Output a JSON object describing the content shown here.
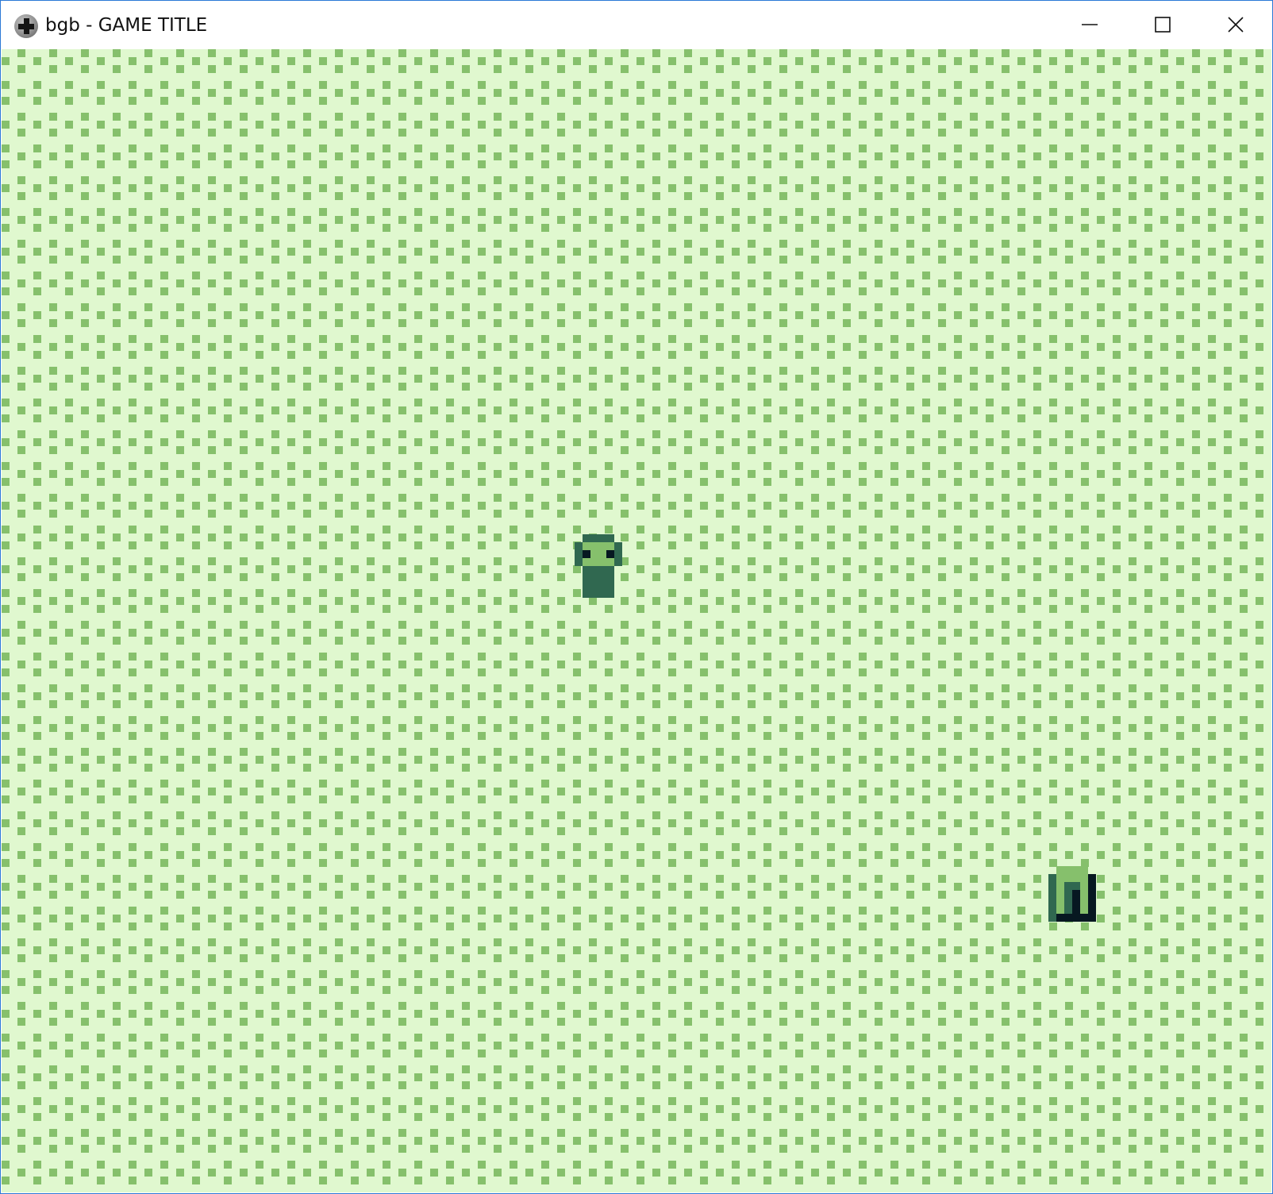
{
  "window": {
    "title": "bgb - GAME TITLE",
    "app_icon": "gamepad-dpad-icon",
    "controls": {
      "minimize_icon": "minimize-icon",
      "maximize_icon": "maximize-icon",
      "close_icon": "close-icon"
    },
    "border_color": "#2b79d6"
  },
  "game": {
    "palette": {
      "lightest": "#e0f8cf",
      "light": "#86c06c",
      "dark": "#306850",
      "darkest": "#071821"
    },
    "background_tile": "grass-pattern",
    "sprites": [
      {
        "kind": "player",
        "icon": "player-character-icon"
      },
      {
        "kind": "item",
        "icon": "door-item-icon"
      }
    ]
  }
}
